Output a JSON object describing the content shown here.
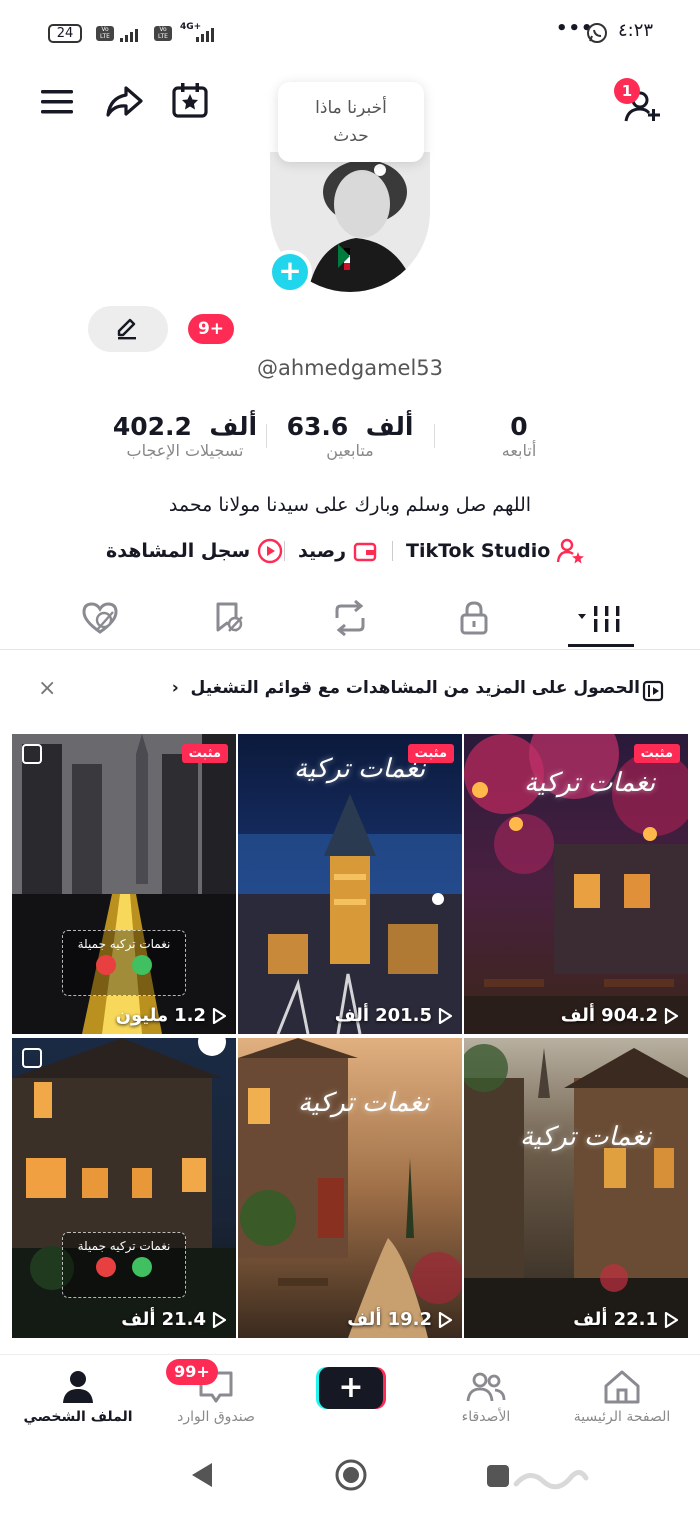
{
  "status_bar": {
    "battery": "24",
    "network": "4G+",
    "time": "٤:٢٣",
    "more": "•••"
  },
  "header": {
    "notification_count": "1",
    "tooltip": [
      "أخبرنا ماذا",
      "حدث"
    ]
  },
  "profile": {
    "username": "@ahmedgamel53",
    "badge": "9+",
    "stats": [
      {
        "value": "402.2",
        "unit": "ألف",
        "label": "تسجيلات الإعجاب"
      },
      {
        "value": "63.6",
        "unit": "ألف",
        "label": "متابعين"
      },
      {
        "value": "0",
        "unit": "",
        "label": "أتابعه"
      }
    ],
    "bio": "اللهم صل وسلم وبارك على سيدنا مولانا محمد",
    "links": {
      "studio": "TikTok Studio",
      "balance": "رصيد",
      "history": "سجل المشاهدة"
    }
  },
  "banner": {
    "text": "الحصول على المزيد من المشاهدات مع قوائم التشغيل",
    "chevron": "‹",
    "close": "×"
  },
  "videos": [
    {
      "pinned": "مثبت",
      "views": "904.2",
      "unit": "ألف",
      "caption": "نغمات تركية"
    },
    {
      "pinned": "مثبت",
      "views": "201.5",
      "unit": "ألف",
      "caption": "نغمات تركية"
    },
    {
      "pinned": "مثبت",
      "views": "1.2",
      "unit": "مليون",
      "caption": "",
      "card": "نغمات تركيه جميلة"
    },
    {
      "pinned": "",
      "views": "22.1",
      "unit": "ألف",
      "caption": "نغمات تركية"
    },
    {
      "pinned": "",
      "views": "19.2",
      "unit": "ألف",
      "caption": "نغمات تركية"
    },
    {
      "pinned": "",
      "views": "21.4",
      "unit": "ألف",
      "caption": "",
      "card": "نغمات تركيه جميلة"
    }
  ],
  "bottom_nav": {
    "home": "الصفحة الرئيسية",
    "friends": "الأصدقاء",
    "inbox": "صندوق الوارد",
    "inbox_badge": "99+",
    "profile": "الملف الشخصي",
    "create": "+"
  },
  "colors": {
    "accent": "#fe2c55",
    "cyan": "#20d5ec",
    "text": "#161823"
  }
}
